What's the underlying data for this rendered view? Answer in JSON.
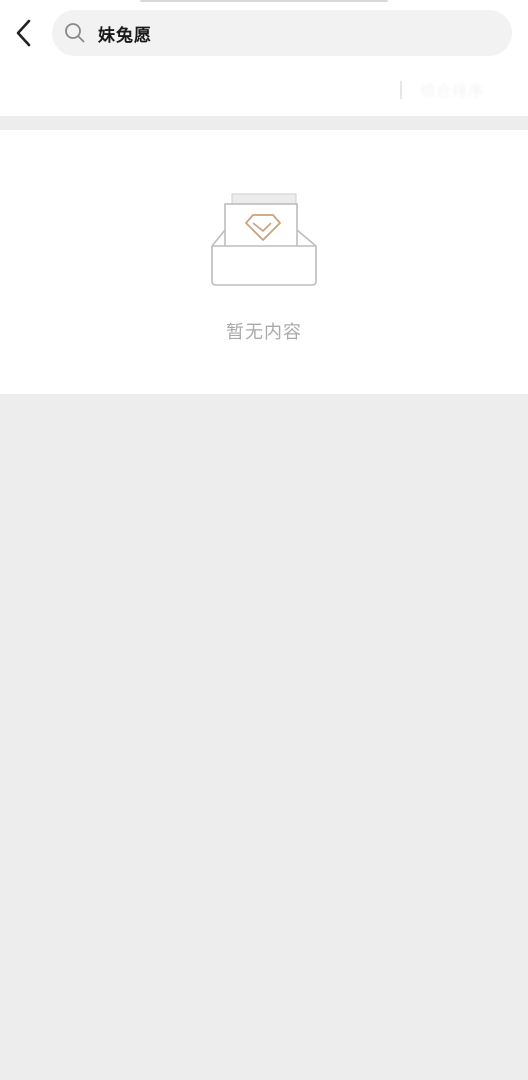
{
  "search": {
    "query": "妹兔愿"
  },
  "filter": {
    "label": "综合排序"
  },
  "empty_state": {
    "message": "暂无内容",
    "illustration": "empty-box-diamond-icon"
  },
  "icons": {
    "back": "back-arrow-icon",
    "search": "search-icon"
  },
  "colors": {
    "background": "#ededed",
    "surface": "#ffffff",
    "accent": "#c9a27e",
    "muted_text": "#aaaaaa"
  }
}
